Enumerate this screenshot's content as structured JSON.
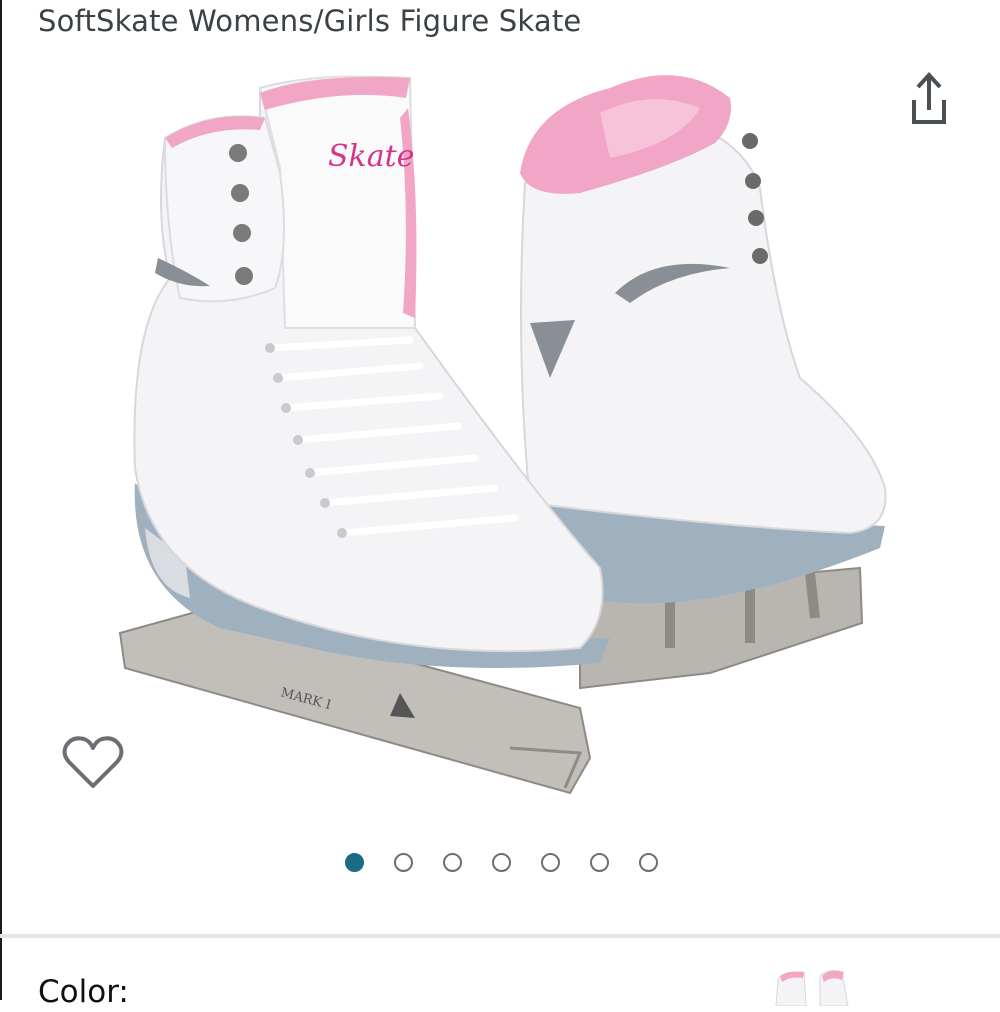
{
  "product": {
    "title": "SoftSkate Womens/Girls Figure Skate",
    "image_alt": "SoftSkate Womens/Girls Figure Skate",
    "blade_marking": "MARK I",
    "boot_brand": "Skate",
    "image_count": 7,
    "active_image_index": 0
  },
  "actions": {
    "share_icon": "share-icon",
    "wishlist_icon": "heart-outline-icon"
  },
  "variation": {
    "color_label": "Color:"
  },
  "colors": {
    "accent_dot": "#1b6b84",
    "boot_white": "#f4f4f6",
    "lining_pink": "#f2a6c6",
    "sole_gray": "#9fb0bf",
    "blade_silver": "#b9b6b2"
  }
}
